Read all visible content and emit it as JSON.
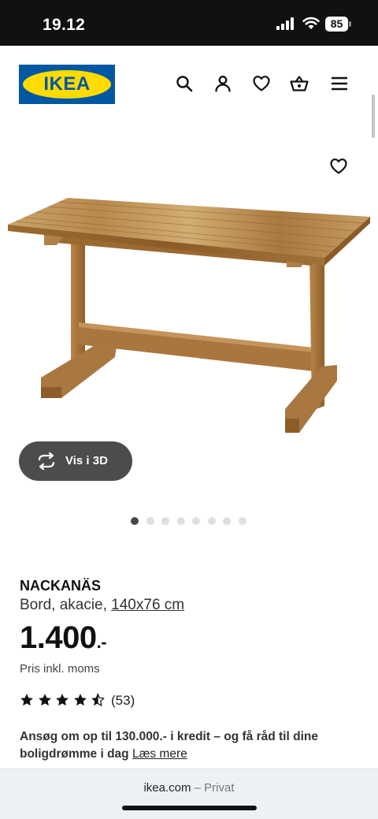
{
  "status_bar": {
    "time": "19.12",
    "battery": "85",
    "icons": [
      "cellular-signal-icon",
      "wifi-icon",
      "battery-icon"
    ]
  },
  "header": {
    "logo_text": "IKEA",
    "icons": [
      "search-icon",
      "account-icon",
      "wishlist-heart-icon",
      "shopping-bag-icon",
      "menu-icon"
    ],
    "colors": {
      "logo_blue": "#0058a3",
      "logo_yellow": "#ffdb00"
    }
  },
  "gallery": {
    "favorite_icon": "heart-outline-icon",
    "view_3d_label": "Vis i 3D",
    "view_3d_icon": "rotate-arrows-icon",
    "slide_count": 8,
    "active_slide": 1
  },
  "product": {
    "name": "NACKANÄS",
    "description": "Bord, akacie, ",
    "size_link": "140x76 cm",
    "price": "1.400",
    "price_suffix": ".-",
    "vat_note": "Pris inkl. moms",
    "rating_stars": 4.5,
    "rating_count": "(53)",
    "credit_text": "Ansøg om op til 130.000.- i kredit – og få råd til dine boligdrømme i dag",
    "credit_link": "Læs mere"
  },
  "browser": {
    "domain": "ikea.com",
    "mode": " – Privat"
  }
}
